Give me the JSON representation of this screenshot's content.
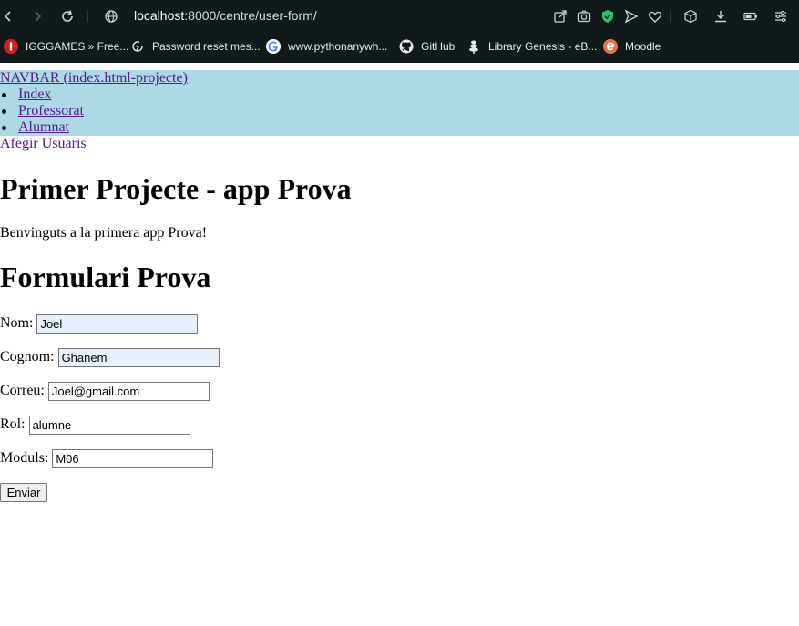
{
  "browser": {
    "url_host": "localhost",
    "url_path": ":8000/centre/user-form/",
    "bookmarks": [
      {
        "label": "IGGGAMES » Free...",
        "icon": "igg-icon"
      },
      {
        "label": "Password reset mes...",
        "icon": "refresh-fav-icon"
      },
      {
        "label": "www.pythonanywh...",
        "icon": "google-icon"
      },
      {
        "label": "GitHub",
        "icon": "github-icon"
      },
      {
        "label": "Library Genesis - eB...",
        "icon": "libgen-icon"
      },
      {
        "label": "Moodle",
        "icon": "moodle-icon"
      }
    ]
  },
  "navbar": {
    "brand": "NAVBAR (index.html-projecte)",
    "items": [
      {
        "label": "Index"
      },
      {
        "label": "Professorat"
      },
      {
        "label": "Alumnat"
      }
    ],
    "extra_link": "Afegir Usuaris",
    "bg_color": "#add8e6"
  },
  "main": {
    "title": "Primer Projecte - app Prova",
    "intro": "Benvinguts a la primera app Prova!",
    "form_title": "Formulari Prova"
  },
  "form": {
    "fields": [
      {
        "label": "Nom:",
        "value": "Joel",
        "autofilled": true
      },
      {
        "label": "Cognom:",
        "value": "Ghanem",
        "autofilled": true
      },
      {
        "label": "Correu:",
        "value": "Joel@gmail.com",
        "autofilled": false
      },
      {
        "label": "Rol:",
        "value": "alumne",
        "autofilled": false
      },
      {
        "label": "Moduls:",
        "value": "M06",
        "autofilled": false
      }
    ],
    "submit_label": "Enviar"
  }
}
